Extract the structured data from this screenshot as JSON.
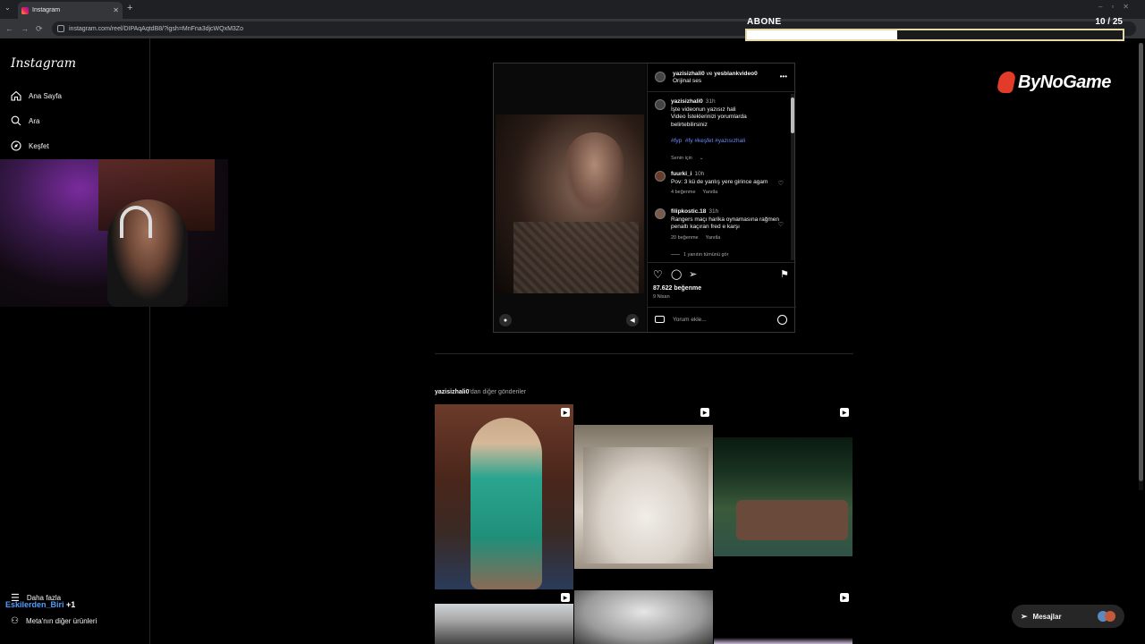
{
  "browser": {
    "tab_title": "Instagram",
    "url_host": "instagram.com",
    "url_path": "/reel/DIPAqAqtdB8/?igsh=MnFna3djcWQxM3Zo"
  },
  "overlay": {
    "sub_label": "ABONE",
    "sub_count": "10 / 25",
    "sub_progress": 0.4,
    "brand": "ByNoGame"
  },
  "sidebar": {
    "logo": "Instagram",
    "items": [
      {
        "label": "Ana Sayfa",
        "icon": "home-icon"
      },
      {
        "label": "Ara",
        "icon": "search-icon"
      },
      {
        "label": "Keşfet",
        "icon": "compass-icon"
      }
    ],
    "more": "Daha fazla",
    "meta": "Meta'nın diğer ürünleri"
  },
  "stream": {
    "chat_user": "Eskilerden_Biri",
    "chat_extra": "+1"
  },
  "post": {
    "author": "yazisizhali0",
    "connector": "ve",
    "coauthor": "yesblankvideo0",
    "audio": "Orijinal ses",
    "caption": {
      "user": "yazisizhali0",
      "time": "31h",
      "lines": [
        "İşte videonun yazısız hali",
        "Video İsteklerinizi yorumlarda",
        "belirtebilirsiniz"
      ],
      "tags": "#fyp  #fy #keşfet #yazısızhali",
      "for_you": "Senin için"
    },
    "comments": [
      {
        "user": "fuurki_i",
        "time": "10h",
        "text": "Pov: 3 kü de yanlış yere girince agam",
        "likes": "4 beğenme",
        "reply": "Yanıtla"
      },
      {
        "user": "filipkostic.18",
        "time": "31h",
        "text": "Rangers maçı harika oynamasına rağmen penaltı kaçıran fred e karşı",
        "likes": "20 beğenme",
        "reply": "Yanıtla"
      }
    ],
    "view_replies": "1 yanıtın tümünü gör",
    "like_count": "87.622 beğenme",
    "date": "9 Nisan",
    "comment_placeholder": "Yorum ekle..."
  },
  "more_posts": {
    "user": "yazisizhali0",
    "suffix": "'dan diğer gönderiler"
  },
  "messages": {
    "label": "Mesajlar"
  }
}
